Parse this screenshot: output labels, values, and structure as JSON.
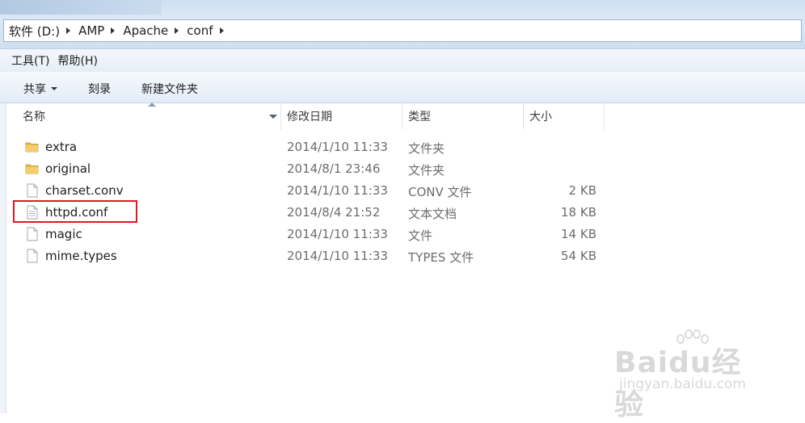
{
  "address": {
    "crumbs": [
      "软件 (D:)",
      "AMP",
      "Apache",
      "conf"
    ]
  },
  "menu": {
    "tools": "工具(T)",
    "help": "帮助(H)"
  },
  "toolbar": {
    "share": "共享",
    "burn": "刻录",
    "new_folder": "新建文件夹"
  },
  "columns": {
    "name": "名称",
    "modified": "修改日期",
    "type": "类型",
    "size": "大小"
  },
  "files": [
    {
      "name": "extra",
      "modified": "2014/1/10 11:33",
      "type": "文件夹",
      "size": "",
      "icon": "folder-icon"
    },
    {
      "name": "original",
      "modified": "2014/8/1 23:46",
      "type": "文件夹",
      "size": "",
      "icon": "folder-icon"
    },
    {
      "name": "charset.conv",
      "modified": "2014/1/10 11:33",
      "type": "CONV 文件",
      "size": "2 KB",
      "icon": "file-icon"
    },
    {
      "name": "httpd.conf",
      "modified": "2014/8/4 21:52",
      "type": "文本文档",
      "size": "18 KB",
      "icon": "text-file-icon"
    },
    {
      "name": "magic",
      "modified": "2014/1/10 11:33",
      "type": "文件",
      "size": "14 KB",
      "icon": "file-icon"
    },
    {
      "name": "mime.types",
      "modified": "2014/1/10 11:33",
      "type": "TYPES 文件",
      "size": "54 KB",
      "icon": "file-icon"
    }
  ],
  "highlighted_file": "httpd.conf",
  "watermark": {
    "logo": "Baidu经验",
    "url": "jingyan.baidu.com"
  },
  "colors": {
    "highlight_border": "#e0191e",
    "folder_yellow": "#e8b84a"
  }
}
